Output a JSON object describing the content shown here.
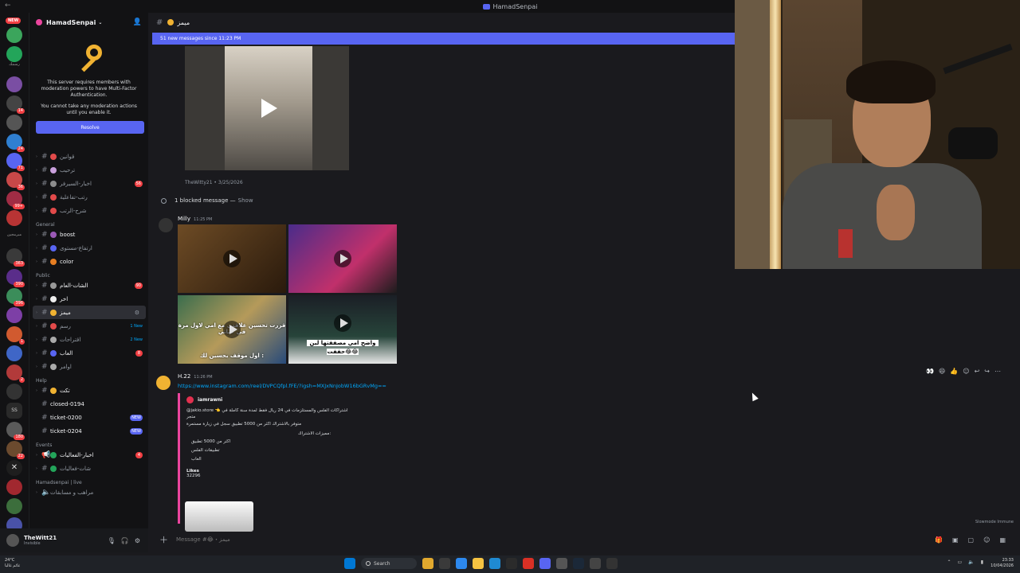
{
  "window": {
    "title": "HamadSenpai"
  },
  "rail": {
    "new_label": "NEW",
    "folder_label_1": "رسمك",
    "folder_label_2": "مبرمجين",
    "badges": [
      "14",
      "24",
      "71",
      "36",
      "99+",
      "363",
      "390",
      "396",
      "1",
      "2",
      "3",
      "180",
      "22"
    ]
  },
  "server": {
    "name": "HamadSenpai",
    "mfa_text": "This server requires members with moderation powers to have Multi-Factor Authentication.",
    "mfa_sub": "You cannot take any moderation actions until you enable it.",
    "resolve_label": "Resolve"
  },
  "channels": {
    "top": [
      {
        "name": "قوانين",
        "badge": ""
      },
      {
        "name": "ترحيب",
        "badge": ""
      },
      {
        "name": "اخبار-السيرفر",
        "badge": "56"
      },
      {
        "name": "رتب-تفاعلية",
        "badge": ""
      },
      {
        "name": "شرح-الرتب",
        "badge": ""
      }
    ],
    "general_label": "General",
    "general": [
      {
        "name": "boost"
      },
      {
        "name": "ارتفاع-مستوى"
      },
      {
        "name": "color"
      }
    ],
    "public_label": "Public",
    "public": [
      {
        "name": "الشات-العام",
        "badge": "90"
      },
      {
        "name": "اخر",
        "badge": ""
      },
      {
        "name": "ميمز",
        "badge": ""
      },
      {
        "name": "رسم",
        "badge": "1 New"
      },
      {
        "name": "اقتراحات",
        "badge": "2 New"
      },
      {
        "name": "العاب",
        "badge": "8"
      },
      {
        "name": "اوامر",
        "badge": ""
      }
    ],
    "help_label": "Help",
    "help": [
      {
        "name": "تكت",
        "badge": ""
      },
      {
        "name": "closed-0194",
        "badge": ""
      },
      {
        "name": "ticket-0200",
        "badge": "NEW"
      },
      {
        "name": "ticket-0204",
        "badge": "NEW"
      }
    ],
    "events_label": "Events",
    "events": [
      {
        "name": "اخبار-الفعاليات",
        "badge": "4"
      },
      {
        "name": "شات-فعاليات",
        "badge": ""
      }
    ],
    "live_label": "Hamadsenpai | live",
    "live": [
      {
        "name": "مراهب و مسابقات"
      }
    ]
  },
  "user": {
    "name": "TheWitt21",
    "status": "Invisible"
  },
  "main": {
    "channel_name": "ميمز",
    "new_messages": "51 new messages since 11:23 PM",
    "video_author": "TheWitty21 • 3/25/2026",
    "blocked_text": "1 blocked message —",
    "blocked_show": "Show",
    "grid_author": "Milly",
    "grid_time": "11:25 PM",
    "grid_captions": [
      "قررت تحسين علاقتي مع امي لاول مرة في حياتي",
      "اول موقف بحسين لك :",
      "واضح امي مصفقتها لين",
      "حففت😂😂"
    ],
    "msg_author": "H.22",
    "msg_time": "11:26 PM",
    "msg_link": "https://www.instagram.com/reel/DVPCQfpl.fFE/?igsh=MXJxNnJobW16bGRvMg==",
    "embed_author": "iamrawni",
    "embed_line1": "@jakio.store 👈 اشتراكات الفلس والمستلزمات في 24 ريال فقط لمدة سنة كاملة في متجر",
    "embed_line2": "متوفر بالاشتراك اكثر من 5000 تطبيق سجل في زيارة مستمرة",
    "embed_line3": "مميزات الاشتراك:",
    "embed_bullets": [
      "اكثر من 5000 تطبيق",
      "تطبيقات الفلس",
      "العاب"
    ],
    "likes_label": "Likes",
    "likes_value": "32296",
    "slowmode": "Slowmode Immune",
    "composer_placeholder": "Message #😂・ميمز"
  },
  "taskbar": {
    "weather_temp": "24°C",
    "weather_desc": "غائم غالبا",
    "search_label": "Search",
    "time": "23:33",
    "date": "10/04/2026"
  },
  "colors": {
    "accent": "#5865f2",
    "danger": "#f23f43",
    "link": "#00a8fc"
  }
}
